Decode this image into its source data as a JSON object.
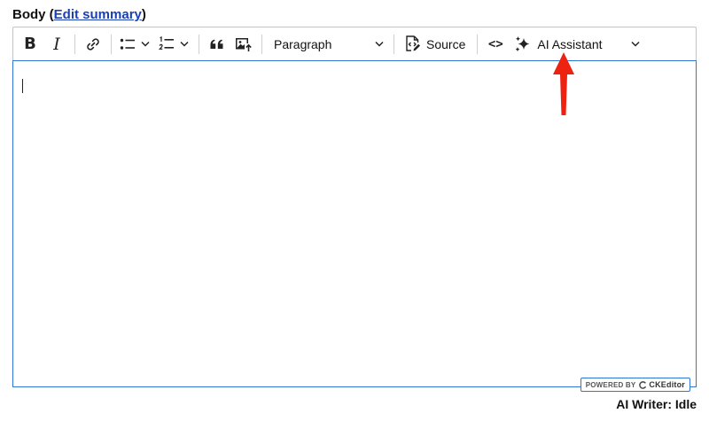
{
  "field": {
    "label_prefix": "Body (",
    "link_text": "Edit summary",
    "label_suffix": ")"
  },
  "toolbar": {
    "bold_label": "B",
    "italic_label": "I",
    "heading_value": "Paragraph",
    "source_label": "Source",
    "code_label": "<>",
    "ai_label": "AI Assistant",
    "icons": {
      "link": "link-icon",
      "bulleted_list": "bulleted-list-icon",
      "numbered_list": "numbered-list-icon",
      "block_quote": "block-quote-icon",
      "image": "image-upload-icon",
      "source": "source-editing-icon",
      "ai": "sparkles-icon",
      "dropdown": "chevron-down-icon"
    }
  },
  "editor": {
    "powered_by": "POWERED BY",
    "brand": "CKEditor",
    "focus_border_color": "#2f75d6"
  },
  "status": {
    "text": "AI Writer: Idle"
  },
  "annotation": {
    "arrow_color": "#ee2211",
    "points_to": "ai-assistant-button"
  }
}
